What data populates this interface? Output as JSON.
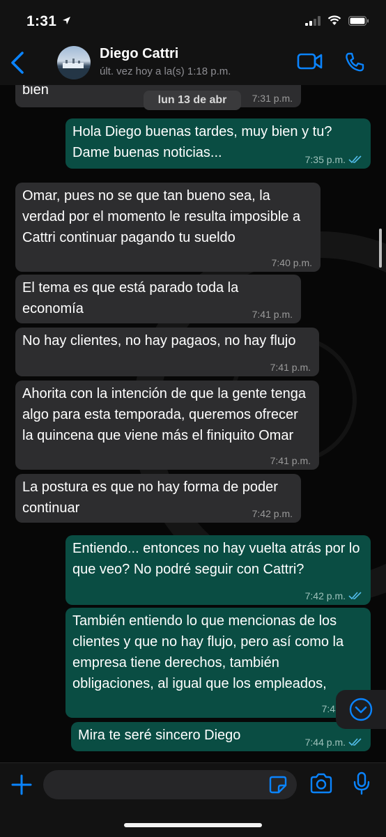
{
  "status_bar": {
    "time": "1:31"
  },
  "header": {
    "contact_name": "Diego Cattri",
    "last_seen": "últ. vez hoy a la(s) 1:18 p.m."
  },
  "date_pill": "lun 13 de abr",
  "messages": [
    {
      "direction": "in",
      "text": "bien",
      "time": "7:31 p.m."
    },
    {
      "direction": "out",
      "text": "Hola Diego buenas tardes, muy bien y tu? Dame buenas noticias...",
      "time": "7:35 p.m."
    },
    {
      "direction": "in",
      "text": "Omar, pues no se que tan bueno sea, la verdad por el momento le resulta imposible a Cattri continuar pagando tu sueldo",
      "time": "7:40 p.m."
    },
    {
      "direction": "in",
      "text": "El tema es que está parado toda la economía",
      "time": "7:41 p.m."
    },
    {
      "direction": "in",
      "text": "No hay clientes, no hay pagaos, no hay flujo",
      "time": "7:41 p.m."
    },
    {
      "direction": "in",
      "text": "Ahorita con la intención de que la gente tenga algo para esta temporada, queremos ofrecer la quincena que viene más el finiquito Omar",
      "time": "7:41 p.m."
    },
    {
      "direction": "in",
      "text": "La postura es que no hay forma de poder continuar",
      "time": "7:42 p.m."
    },
    {
      "direction": "out",
      "text": "Entiendo... entonces no hay vuelta atrás por lo que veo? No podré seguir con Cattri?",
      "time": "7:42 p.m."
    },
    {
      "direction": "out",
      "text": "También entiendo lo que mencionas de los clientes y que no hay flujo, pero así como la empresa tiene derechos, también obligaciones, al igual que los empleados,",
      "time": "7:43 p.m."
    },
    {
      "direction": "out",
      "text": "Mira te seré sincero Diego",
      "time": "7:44 p.m."
    }
  ],
  "colors": {
    "accent": "#0a84ff",
    "bubble_in": "#2d2d2f",
    "bubble_out": "#0a4d43",
    "read_ticks": "#53bdeb"
  },
  "icons": {
    "back": "chevron-left-icon",
    "video": "video-camera-icon",
    "call": "phone-icon",
    "add": "plus-icon",
    "sticker": "sticker-icon",
    "camera": "camera-icon",
    "mic": "microphone-icon",
    "scroll": "chevron-down-icon"
  }
}
